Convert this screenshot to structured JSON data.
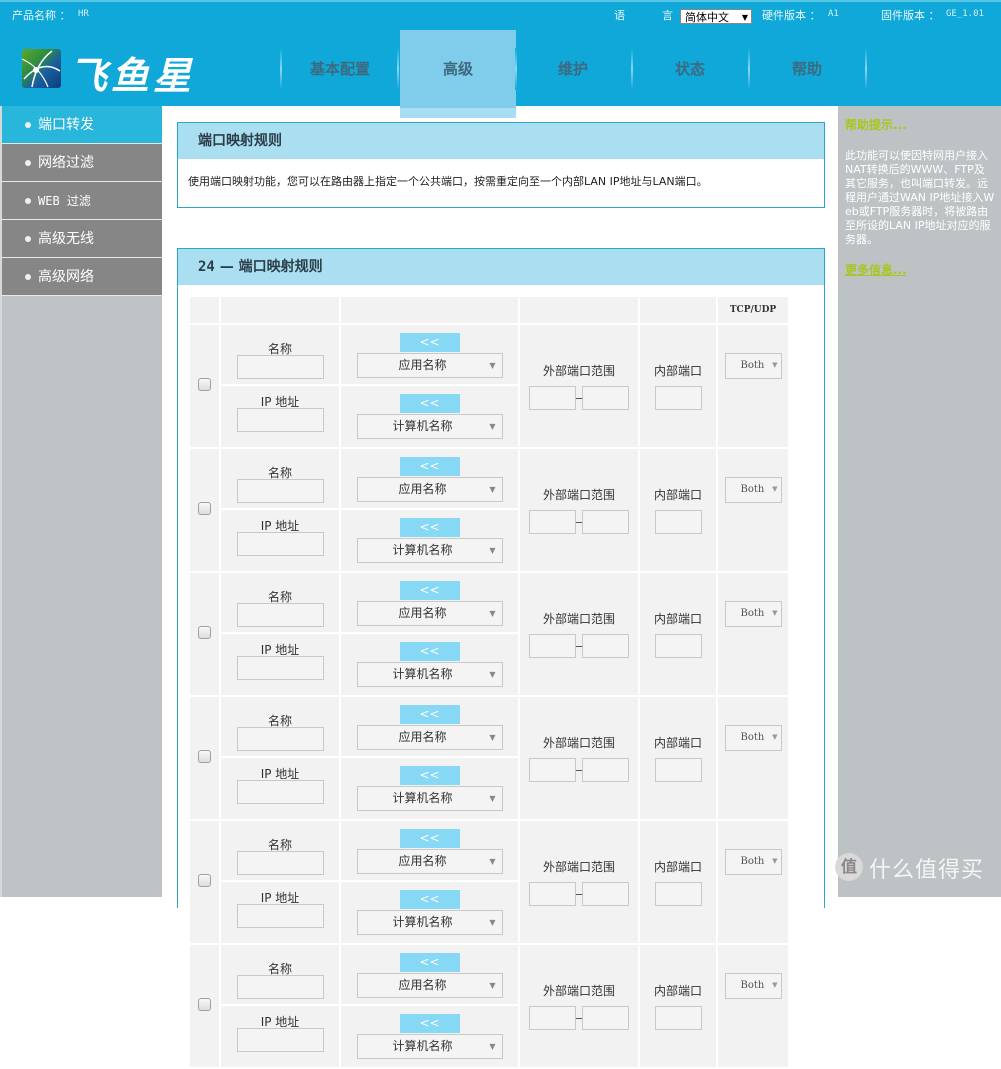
{
  "header": {
    "product_label": "产品名称 ：",
    "product_value": "HR",
    "language_label_1": "语",
    "language_label_2": "言",
    "language_selected": "简体中文",
    "hardware_label": "硬件版本 ：",
    "hardware_value": "A1",
    "firmware_label": "固件版本 ：",
    "firmware_value": "GE_1.01",
    "brand": "飞鱼星",
    "nav": [
      {
        "label": "基本配置",
        "active": false
      },
      {
        "label": "高级",
        "active": true
      },
      {
        "label": "维护",
        "active": false
      },
      {
        "label": "状态",
        "active": false
      },
      {
        "label": "帮助",
        "active": false
      }
    ]
  },
  "sidebar": {
    "items": [
      {
        "label": "端口转发",
        "active": true
      },
      {
        "label": "网络过滤",
        "active": false
      },
      {
        "label": "WEB 过滤",
        "active": false
      },
      {
        "label": "高级无线",
        "active": false
      },
      {
        "label": "高级网络",
        "active": false
      }
    ]
  },
  "help": {
    "title": "帮助提示...",
    "text": "此功能可以使因特网用户接入NAT转换后的WWW、FTP及其它服务，也叫端口转发。远程用户通过WAN IP地址接入Web或FTP服务器时，将被路由至所设的LAN IP地址对应的服务器。",
    "more": "更多信息..."
  },
  "intro_panel": {
    "title": "端口映射规则",
    "description": "使用端口映射功能，您可以在路由器上指定一个公共端口，按需重定向至一个内部LAN IP地址与LAN端口。"
  },
  "rules_panel": {
    "count": "24",
    "separator": "—",
    "title": "端口映射规则",
    "header_protocol": "TCP/UDP",
    "labels": {
      "name": "名称",
      "ip": "IP 地址",
      "shift": "<<",
      "app_name": "应用名称",
      "computer_name": "计算机名称",
      "external_range": "外部端口范围",
      "internal_port": "内部端口",
      "protocol": "Both"
    },
    "rows": [
      {
        "checked": false,
        "name": "",
        "ip": "",
        "ext_start": "",
        "ext_end": "",
        "internal": "",
        "protocol": "Both"
      },
      {
        "checked": false,
        "name": "",
        "ip": "",
        "ext_start": "",
        "ext_end": "",
        "internal": "",
        "protocol": "Both"
      },
      {
        "checked": false,
        "name": "",
        "ip": "",
        "ext_start": "",
        "ext_end": "",
        "internal": "",
        "protocol": "Both"
      },
      {
        "checked": false,
        "name": "",
        "ip": "",
        "ext_start": "",
        "ext_end": "",
        "internal": "",
        "protocol": "Both"
      },
      {
        "checked": false,
        "name": "",
        "ip": "",
        "ext_start": "",
        "ext_end": "",
        "internal": "",
        "protocol": "Both"
      },
      {
        "checked": false,
        "name": "",
        "ip": "",
        "ext_start": "",
        "ext_end": "",
        "internal": "",
        "protocol": "Both"
      }
    ]
  },
  "watermark": {
    "badge": "值",
    "text": "什么值得买"
  }
}
